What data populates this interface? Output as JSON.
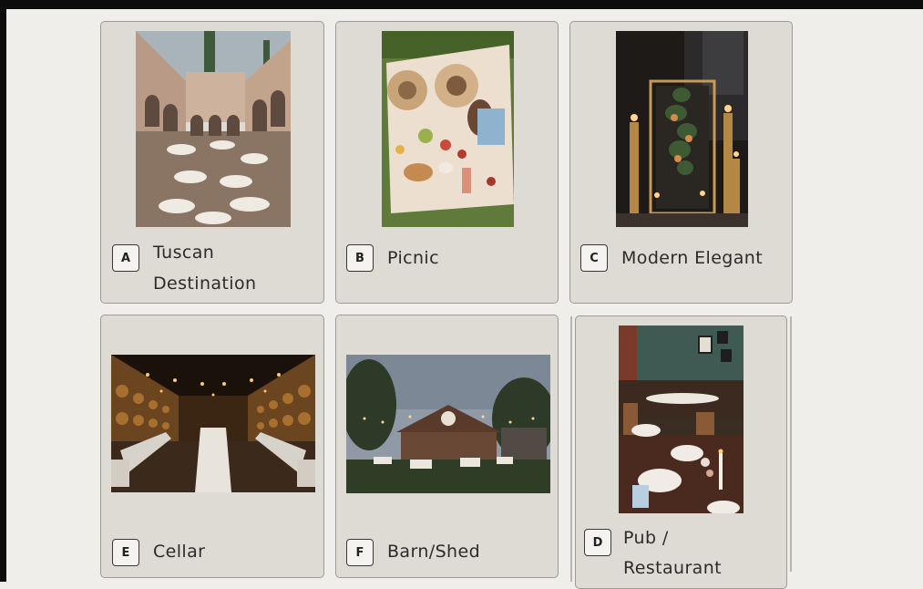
{
  "cards": [
    {
      "letter": "A",
      "line1": "Tuscan",
      "line2": "Destination"
    },
    {
      "letter": "B",
      "line1": "Picnic"
    },
    {
      "letter": "C",
      "line1": "Modern Elegant"
    },
    {
      "letter": "E",
      "line1": "Cellar"
    },
    {
      "letter": "F",
      "line1": "Barn/Shed"
    },
    {
      "letter": "D",
      "line1": "Pub /",
      "line2": "Restaurant"
    }
  ],
  "colors": {
    "card_bg": "#dedbd5",
    "page_bg": "#efeeea",
    "border": "#9f9b94",
    "text": "#2c2b2a"
  }
}
